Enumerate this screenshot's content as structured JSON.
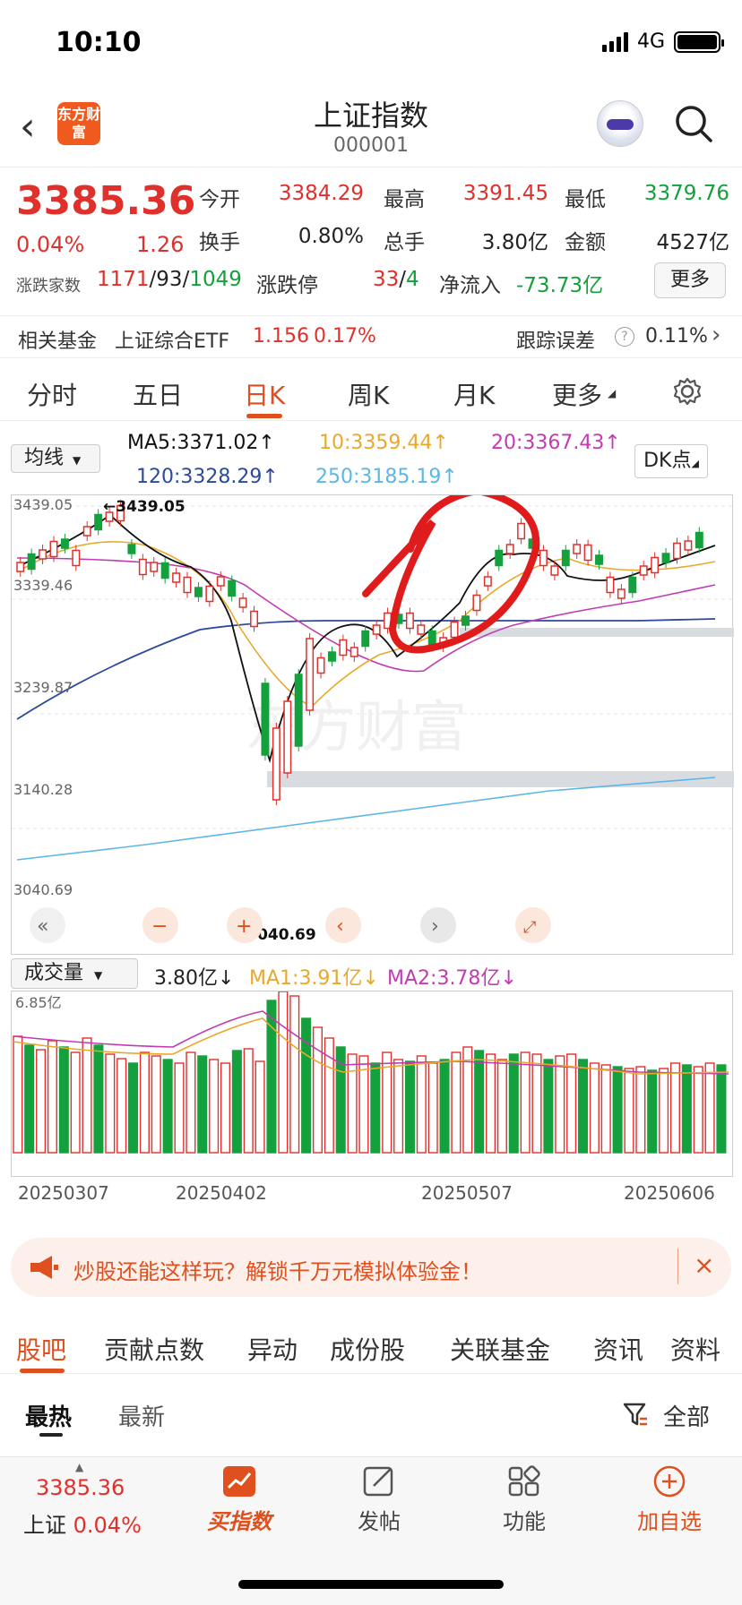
{
  "status": {
    "time": "10:10",
    "network": "4G"
  },
  "nav": {
    "logo_text": "东方财富",
    "title": "上证指数",
    "code": "000001"
  },
  "quote": {
    "price": "3385.36",
    "change_pct": "0.04%",
    "change": "1.26",
    "open_label": "今开",
    "open": "3384.29",
    "high_label": "最高",
    "high": "3391.45",
    "low_label": "最低",
    "low": "3379.76",
    "turnover_label": "换手",
    "turnover": "0.80%",
    "volume_label": "总手",
    "volume": "3.80亿",
    "amount_label": "金额",
    "amount": "4527亿",
    "breadth_label": "涨跌家数",
    "up": "1171",
    "flat": "93",
    "down": "1049",
    "limit_label": "涨跌停",
    "limit_up": "33",
    "limit_down": "4",
    "inflow_label": "净流入",
    "inflow": "-73.73亿",
    "more": "更多"
  },
  "fund": {
    "label": "相关基金",
    "name": "上证综合ETF",
    "price": "1.156",
    "pct": "0.17%",
    "err_label": "跟踪误差",
    "err": "0.11%"
  },
  "tabs": [
    "分时",
    "五日",
    "日K",
    "周K",
    "月K",
    "更多"
  ],
  "active_tab": "日K",
  "indicators": {
    "selector": "均线",
    "ma5": "MA5:3371.02",
    "ma10": "10:3359.44",
    "ma20": "20:3367.43",
    "ma120": "120:3328.29",
    "ma250": "250:3185.19",
    "dk": "DK点"
  },
  "chart_labels": {
    "y_ticks": [
      "3439.05",
      "3339.46",
      "3239.87",
      "3140.28",
      "3040.69"
    ],
    "high_mark": "3439.05",
    "low_mark": "3040.69",
    "watermark": "东方财富"
  },
  "volume": {
    "selector": "成交量",
    "vol": "3.80亿",
    "ma1": "MA1:3.91亿",
    "ma2": "MA2:3.78亿",
    "max_label": "6.85亿",
    "dates": [
      "20250307",
      "20250402",
      "20250507",
      "20250606"
    ]
  },
  "banner": {
    "text": "炒股还能这样玩？解锁千万元模拟体验金！"
  },
  "bottom_tabs": [
    "股吧",
    "贡献点数",
    "异动",
    "成份股",
    "关联基金",
    "资讯",
    "资料"
  ],
  "sub_tabs": {
    "hot": "最热",
    "new": "最新",
    "filter": "全部"
  },
  "footer": {
    "price": "3385.36",
    "name": "上证",
    "pct": "0.04%",
    "buy_index": "买指数",
    "post": "发帖",
    "function": "功能",
    "add": "加自选"
  },
  "colors": {
    "up": "#e0302b",
    "down": "#14a03c",
    "accent": "#e0501e"
  }
}
